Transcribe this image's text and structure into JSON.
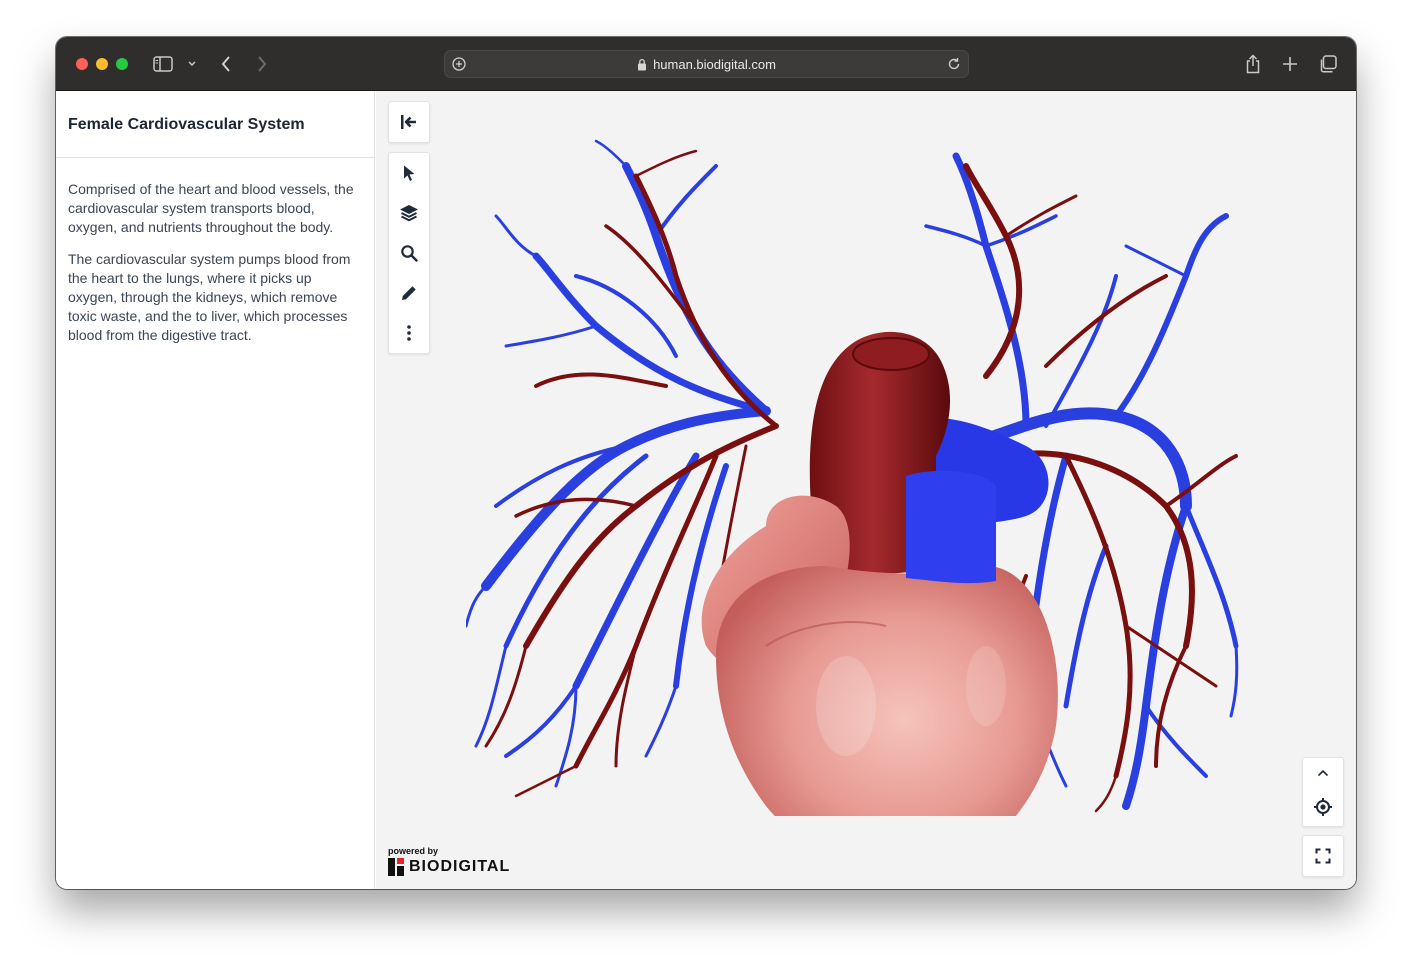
{
  "browser": {
    "url": "human.biodigital.com"
  },
  "sidebar": {
    "title": "Female Cardiovascular System",
    "paragraphs": [
      "Comprised of the heart and blood vessels, the cardiovascular system transports blood, oxygen, and nutrients throughout the body.",
      "The cardiovascular system pumps blood from the heart to the lungs, where it picks up oxygen, through the kidneys, which remove toxic waste, and the to liver, which processes blood from the digestive tract."
    ]
  },
  "viewer": {
    "tools": [
      "collapse-panel-icon",
      "select-icon",
      "layers-icon",
      "search-icon",
      "draw-icon",
      "more-icon"
    ],
    "nav_controls": [
      "chevron-up-icon",
      "locate-icon",
      "fullscreen-icon"
    ],
    "branding": {
      "powered_by": "powered by",
      "brand_name": "BIODIGITAL"
    }
  },
  "colors": {
    "vein_blue": "#2a3fe0",
    "artery_red": "#7a0f0f",
    "heart_pink": "#e8908c",
    "viewer_bg": "#f3f3f3"
  }
}
